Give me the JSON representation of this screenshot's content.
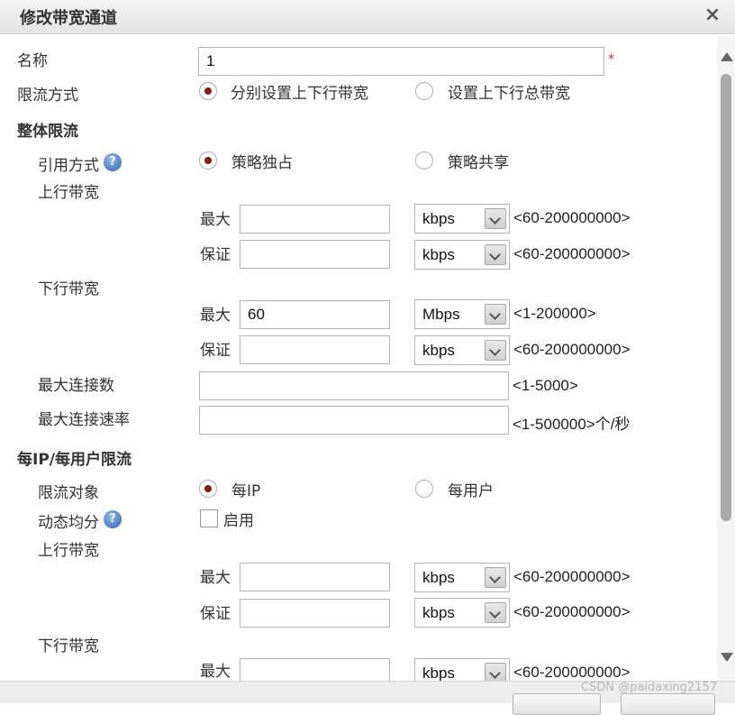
{
  "dialog": {
    "title": "修改带宽通道",
    "close_icon": "×"
  },
  "name_field": {
    "label": "名称",
    "value": "1",
    "required_mark": "*"
  },
  "limit_mode": {
    "label": "限流方式",
    "options": [
      "分别设置上下行带宽",
      "设置上下行总带宽"
    ],
    "selected": 0
  },
  "overall": {
    "header": "整体限流",
    "ref_mode": {
      "label": "引用方式",
      "help": "?",
      "options": [
        "策略独占",
        "策略共享"
      ],
      "selected": 0
    },
    "up": {
      "label": "上行带宽",
      "max": {
        "label": "最大",
        "value": "",
        "unit": "kbps",
        "range": "<60-200000000>"
      },
      "guarantee": {
        "label": "保证",
        "value": "",
        "unit": "kbps",
        "range": "<60-200000000>"
      }
    },
    "down": {
      "label": "下行带宽",
      "max": {
        "label": "最大",
        "value": "60",
        "unit": "Mbps",
        "range": "<1-200000>"
      },
      "guarantee": {
        "label": "保证",
        "value": "",
        "unit": "kbps",
        "range": "<60-200000000>"
      }
    },
    "max_conn": {
      "label": "最大连接数",
      "value": "",
      "range": "<1-5000>"
    },
    "max_conn_rate": {
      "label": "最大连接速率",
      "value": "",
      "range": "<1-500000>个/秒"
    }
  },
  "per_ip": {
    "header": "每IP/每用户限流",
    "target": {
      "label": "限流对象",
      "options": [
        "每IP",
        "每用户"
      ],
      "selected": 0
    },
    "dynamic": {
      "label": "动态均分",
      "help": "?",
      "checkbox_label": "启用",
      "checked": false
    },
    "up": {
      "label": "上行带宽",
      "max": {
        "label": "最大",
        "value": "",
        "unit": "kbps",
        "range": "<60-200000000>"
      },
      "guarantee": {
        "label": "保证",
        "value": "",
        "unit": "kbps",
        "range": "<60-200000000>"
      }
    },
    "down": {
      "label": "下行带宽",
      "max": {
        "label": "最大",
        "value": "",
        "unit": "kbps",
        "range": "<60-200000000>"
      }
    }
  },
  "watermark": "CSDN @paidaxing2157",
  "colors": {
    "radio_selected": "#8b1a1a",
    "required": "#e02020",
    "help_icon": "#2f64b4"
  }
}
